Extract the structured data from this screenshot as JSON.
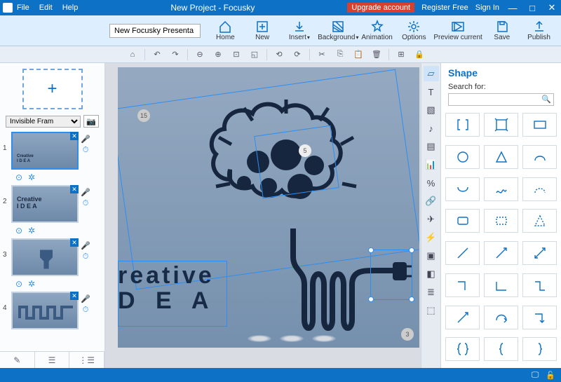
{
  "titlebar": {
    "menu": [
      "File",
      "Edit",
      "Help"
    ],
    "title": "New Project - Focusky",
    "upgrade": "Upgrade account",
    "register": "Register Free",
    "signin": "Sign In"
  },
  "ribbon": {
    "docname": "New Focusky Presenta",
    "items": [
      {
        "label": "Home"
      },
      {
        "label": "New"
      },
      {
        "label": "Insert",
        "caret": true
      },
      {
        "label": "Background",
        "caret": true
      },
      {
        "label": "Animation"
      },
      {
        "label": "Options"
      },
      {
        "label": "Preview current"
      },
      {
        "label": "Save"
      },
      {
        "label": "Publish"
      }
    ]
  },
  "framestyle": {
    "selected": "Invisible Fram"
  },
  "slides": [
    {
      "n": "1",
      "label": "Creative I D E A",
      "active": true
    },
    {
      "n": "2",
      "label": "Creative I D E A"
    },
    {
      "n": "3",
      "label": ""
    },
    {
      "n": "4",
      "label": ""
    }
  ],
  "canvas": {
    "text1": "reative",
    "text2": "D E A",
    "badge1": "15",
    "badge2": "5",
    "badge3": "3"
  },
  "rtool_icons": [
    "▭",
    "T",
    "▧",
    "♪",
    "▤",
    "◪",
    "%",
    "⚲",
    "✈",
    "⚡",
    "▣",
    "◧",
    "≡",
    "⬚"
  ],
  "rightpanel": {
    "title": "Shape",
    "search_label": "Search for:",
    "search_ph": ""
  },
  "shapes_count": 24
}
